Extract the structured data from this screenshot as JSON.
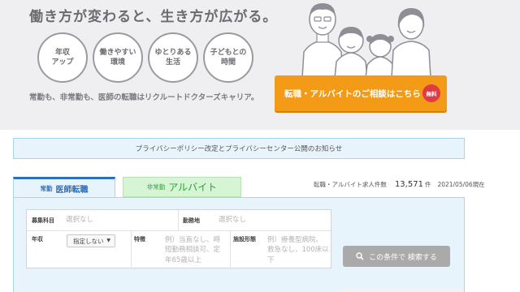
{
  "hero": {
    "tagline": "働き方が変わると、生き方が広がる。",
    "circles": [
      "年収\nアップ",
      "働きやすい\n環境",
      "ゆとりある\n生活",
      "子どもとの\n時間"
    ],
    "subline": "常勤も、非常勤も、医師の転職はリクルートドクターズキャリア。",
    "cta_label": "転職・アルバイトのご相談はこちら",
    "cta_badge": "無料"
  },
  "notice": "プライバシーポリシー改定とプライバシーセンター公開のお知らせ",
  "tabs": {
    "active_small": "常勤",
    "active_main": "医師転職",
    "inactive_small": "非常勤",
    "inactive_main": "アルバイト"
  },
  "stats": {
    "label": "転職・アルバイト求人件数",
    "count": "13,571",
    "unit": "件",
    "date": "2021/05/06現在"
  },
  "form": {
    "specialty_label": "募集科目",
    "specialty_value": "選択なし",
    "location_label": "勤務地",
    "location_value": "選択なし",
    "salary_label": "年収",
    "salary_select": "指定しない",
    "feature_label": "特徴",
    "feature_value": "例）当直なし、時短勤務相談可、定年65歳以上",
    "facility_label": "施設形態",
    "facility_value": "例）療養型病院、救急なし、100床以下"
  },
  "search_button": "この条件で 検索する",
  "colors": {
    "cta": "#f39a16",
    "badge": "#e23a43",
    "tab_blue": "#2a6fc0",
    "tab_green": "#2e9c3a",
    "panel_bg": "#e8f4fc"
  }
}
